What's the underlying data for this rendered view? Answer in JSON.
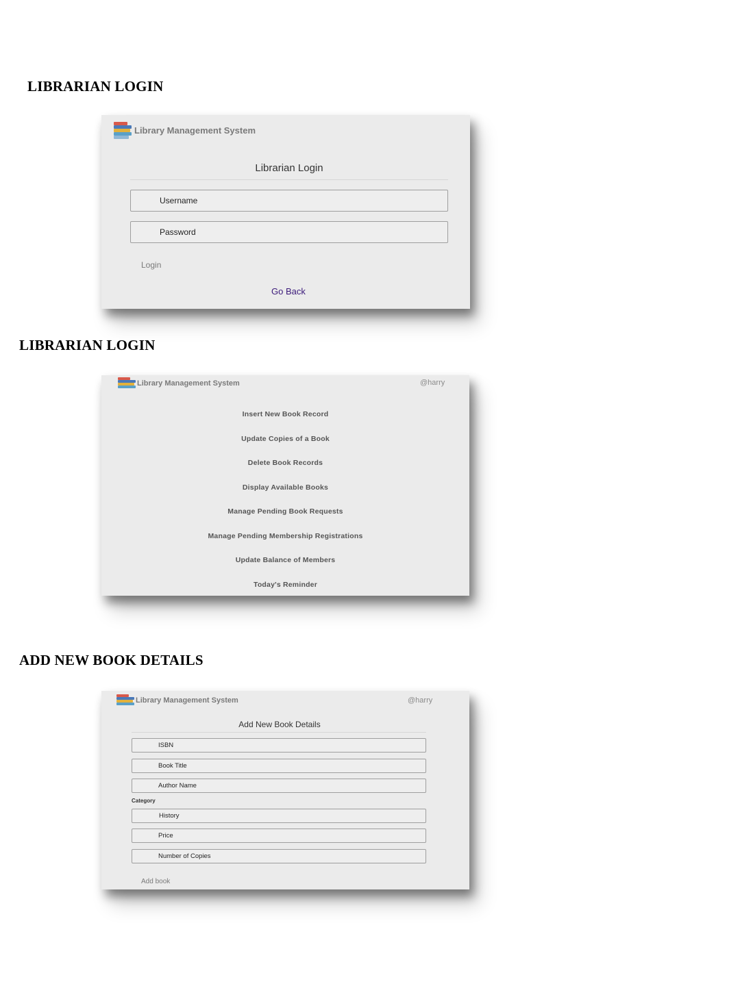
{
  "sections": [
    {
      "heading": "LIBRARIAN LOGIN"
    },
    {
      "heading": "LIBRARIAN LOGIN"
    },
    {
      "heading": "ADD NEW BOOK DETAILS"
    }
  ],
  "app": {
    "title": "Library Management System",
    "user": "@harry",
    "icon": "books-stack-icon"
  },
  "login": {
    "form_title": "Librarian Login",
    "username_placeholder": "Username",
    "password_placeholder": "Password",
    "login_label": "Login",
    "go_back_label": "Go Back"
  },
  "menu": {
    "items": [
      "Insert New Book Record",
      "Update Copies of a Book",
      "Delete Book Records",
      "Display Available Books",
      "Manage Pending Book Requests",
      "Manage Pending Membership Registrations",
      "Update Balance of Members",
      "Today's Reminder"
    ]
  },
  "add_book": {
    "form_title": "Add New Book Details",
    "isbn_placeholder": "ISBN",
    "title_placeholder": "Book Title",
    "author_placeholder": "Author Name",
    "category_label": "Category",
    "category_value": "History",
    "price_placeholder": "Price",
    "copies_placeholder": "Number of Copies",
    "add_label": "Add book"
  },
  "colors": {
    "panel": "#ebebeb",
    "link": "#3b1a7a",
    "muted": "#7a7a7a"
  }
}
